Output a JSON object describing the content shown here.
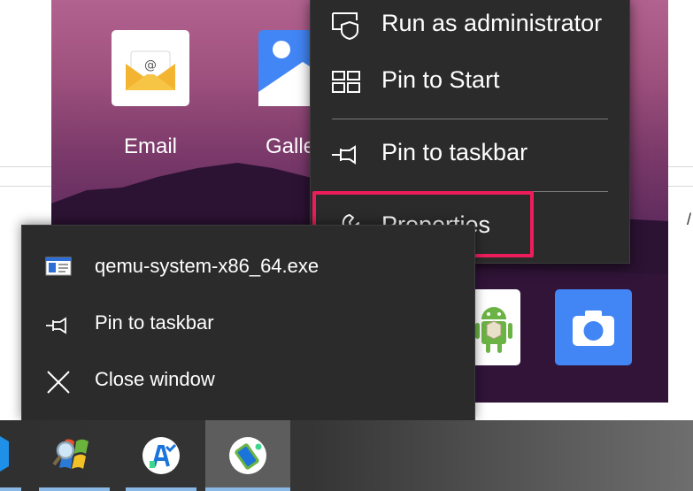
{
  "home_screen": {
    "apps": [
      {
        "label": "Email",
        "icon": "email-envelope-icon"
      },
      {
        "label": "Galle",
        "icon": "gallery-image-icon"
      }
    ],
    "dock_icons": [
      "android-studio-icon",
      "camera-icon"
    ]
  },
  "context_menu": {
    "items": [
      {
        "label": "Run as administrator",
        "icon": "shield-window-icon"
      },
      {
        "label": "Pin to Start",
        "icon": "pin-to-start-icon"
      },
      {
        "label": "Pin to taskbar",
        "icon": "pin-icon"
      },
      {
        "label": "Properties",
        "icon": "wrench-icon"
      }
    ],
    "highlighted": "Properties",
    "highlight_color": "#ed1d5b"
  },
  "window_menu": {
    "items": [
      {
        "label": "qemu-system-x86_64.exe",
        "icon": "app-window-icon"
      },
      {
        "label": "Pin to taskbar",
        "icon": "pin-icon"
      },
      {
        "label": "Close window",
        "icon": "close-icon"
      }
    ]
  },
  "taskbar": {
    "items": [
      {
        "name": "partial-app",
        "icon": "blue-hexagon-icon"
      },
      {
        "name": "windows-xp-search",
        "icon": "windows-flag-magnifier-icon"
      },
      {
        "name": "android-studio",
        "icon": "android-studio-icon"
      },
      {
        "name": "android-emulator",
        "icon": "android-emulator-icon",
        "active": true
      }
    ],
    "accent": "#89b8e6"
  },
  "background_window": {
    "partial_text": "/"
  }
}
